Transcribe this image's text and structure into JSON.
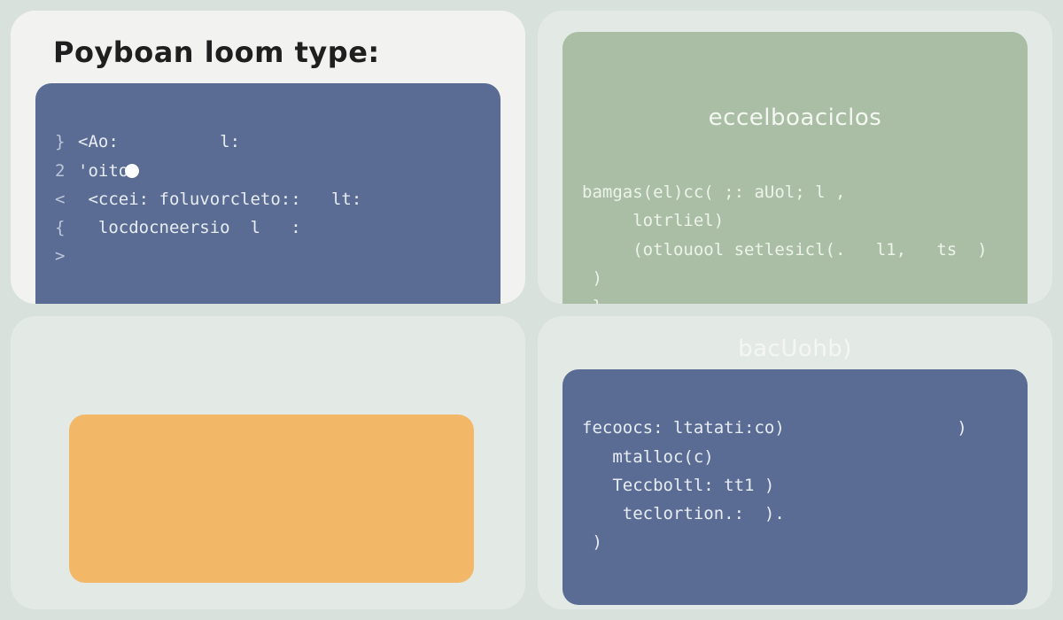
{
  "top_left": {
    "heading": "Poyboan loom type:",
    "lines": [
      {
        "g": "}",
        "t": "<Ao:          l:"
      },
      {
        "g": "2",
        "t": "'oito"
      },
      {
        "g": "<",
        "t": " <ccei: foluvorcleto::   lt:"
      },
      {
        "g": "{",
        "t": "  locdocneersio  l   :"
      },
      {
        "g": ">",
        "t": ""
      }
    ]
  },
  "top_right": {
    "title": "eccelboaciclos",
    "lines": [
      "bamgas(el)cc( ;: aUol; l ,",
      "     lotrliel)",
      "     (otlouool setlesicl(.   l1,   ts  )",
      " )",
      " }"
    ]
  },
  "bottom_left": {},
  "bottom_right": {
    "title": "bacUohb)",
    "lines": [
      "fecoocs: ltatati:co)                 )",
      "   mtalloc(c)",
      "   Teccboltl: tt1 )",
      "    teclortion.:  ).",
      " )"
    ]
  }
}
